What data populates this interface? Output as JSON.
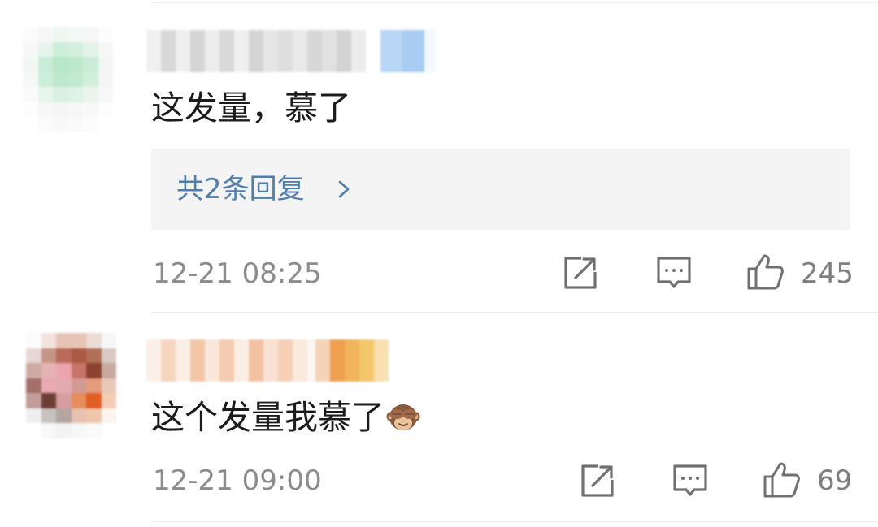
{
  "comments": [
    {
      "text": "这发量，慕了",
      "replies_label": "共2条回复",
      "timestamp": "12-21 08:25",
      "likes": "245"
    },
    {
      "text": "这个发量我慕了",
      "emoji_icon": "see-no-evil-monkey-icon",
      "timestamp": "12-21 09:00",
      "likes": "69"
    }
  ],
  "actions": {
    "share_icon": "share-icon",
    "reply_icon": "comment-icon",
    "like_icon": "thumbs-up-icon"
  },
  "colors": {
    "link": "#4f7db0",
    "meta_text": "#8c8c8c",
    "reply_box_bg": "#f4f4f4",
    "divider": "#ececec"
  }
}
